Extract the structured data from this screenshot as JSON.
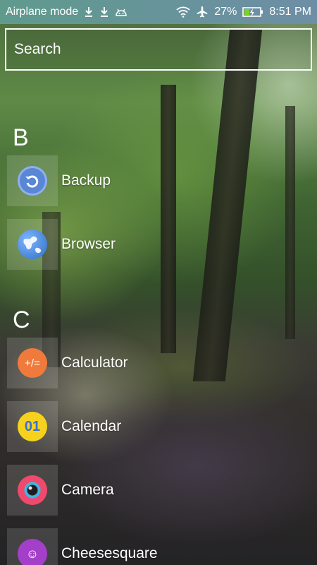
{
  "status_bar": {
    "mode_label": "Airplane mode",
    "battery_percent": "27%",
    "time": "8:51 PM",
    "icons": [
      "download-icon",
      "download-icon",
      "android-icon",
      "wifi-icon",
      "airplane-icon",
      "battery-charging-icon"
    ]
  },
  "search": {
    "placeholder": "Search"
  },
  "sections": [
    {
      "letter": "B",
      "apps": [
        {
          "label": "Backup",
          "icon": "backup-icon",
          "color": "#5a86d6"
        },
        {
          "label": "Browser",
          "icon": "globe-icon",
          "color": "#3f7fd2"
        }
      ]
    },
    {
      "letter": "C",
      "apps": [
        {
          "label": "Calculator",
          "icon": "calculator-icon",
          "color": "#f07a3b",
          "glyph": "+/="
        },
        {
          "label": "Calendar",
          "icon": "calendar-icon",
          "color": "#f6d21e",
          "glyph": "01"
        },
        {
          "label": "Camera",
          "icon": "camera-icon",
          "color": "#ef4a6d"
        },
        {
          "label": "Cheesesquare",
          "icon": "cheesesquare-icon",
          "color": "#a33fc8",
          "glyph": "☺"
        }
      ]
    }
  ]
}
